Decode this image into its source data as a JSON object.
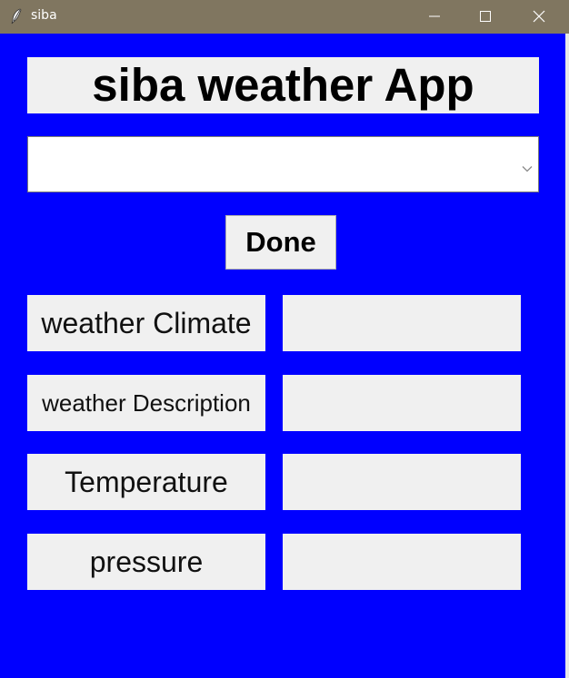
{
  "window": {
    "title": "siba",
    "icon": "feather-icon",
    "controls": [
      "minimize-icon",
      "maximize-icon",
      "close-icon"
    ]
  },
  "colors": {
    "background": "#0000ff",
    "titlebar": "#807660",
    "widget": "#f0f0f0"
  },
  "app": {
    "heading": "siba weather App",
    "city_select": {
      "value": "",
      "icon": "chevron-down-icon"
    },
    "done_label": "Done",
    "fields": [
      {
        "label": "weather Climate",
        "value": ""
      },
      {
        "label": "weather Description",
        "value": ""
      },
      {
        "label": "Temperature",
        "value": ""
      },
      {
        "label": "pressure",
        "value": ""
      }
    ]
  }
}
